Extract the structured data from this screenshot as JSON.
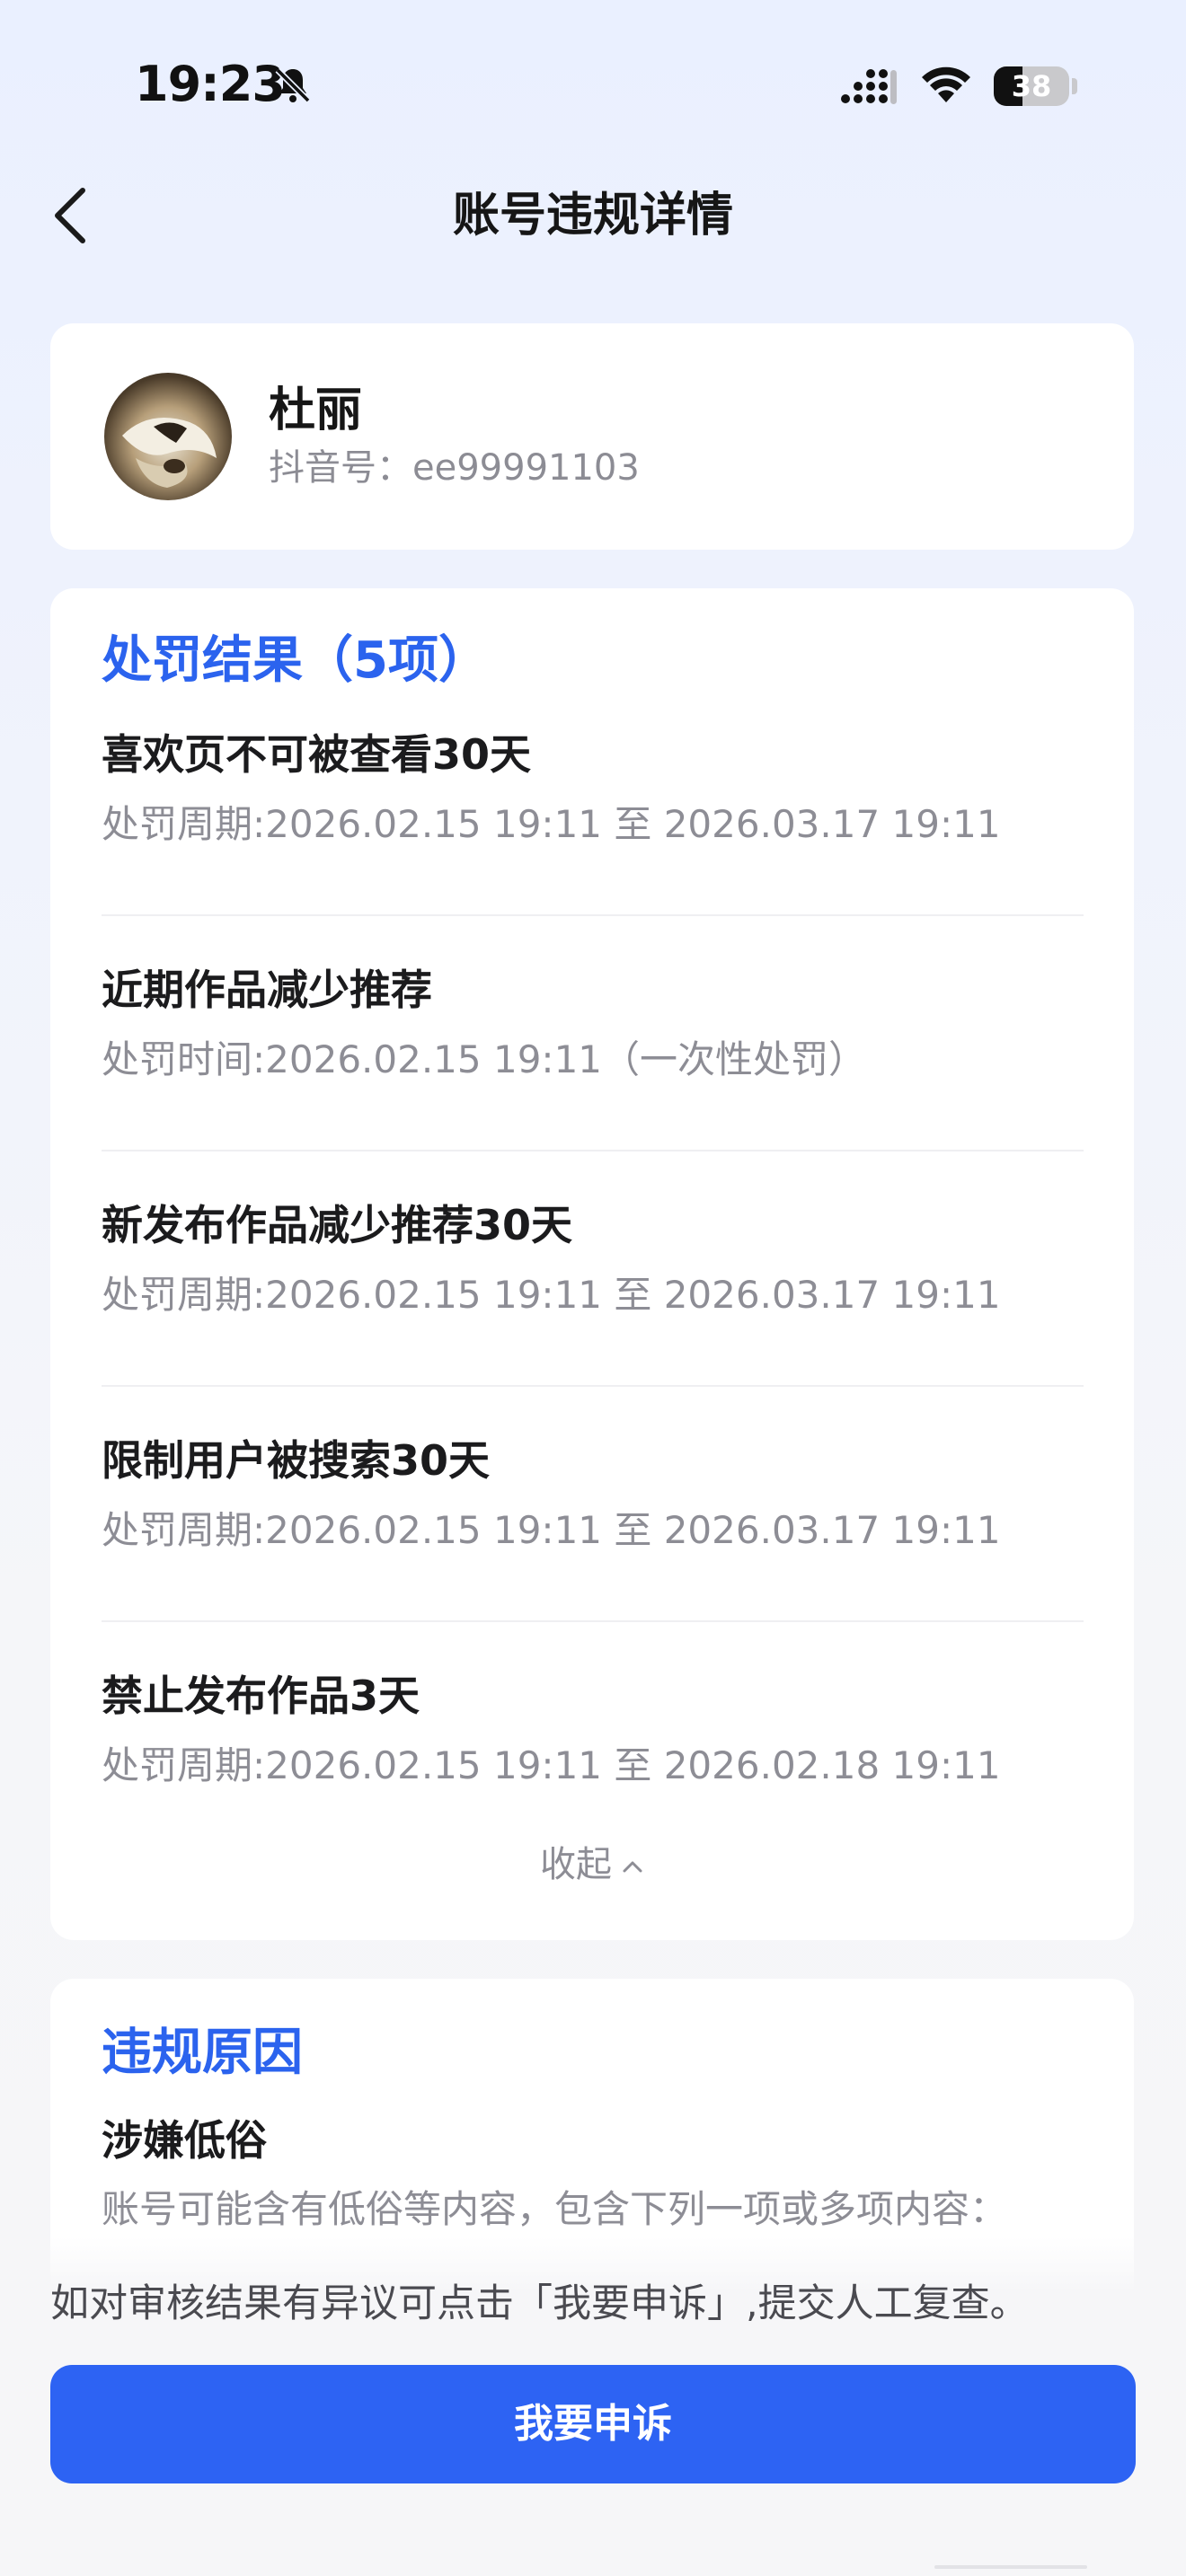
{
  "status_bar": {
    "time": "19:23",
    "battery_level": "38",
    "battery_fraction": 0.38,
    "icons": [
      "bell-muted-icon",
      "signal-icon",
      "wifi-icon",
      "battery-icon"
    ]
  },
  "nav": {
    "back_icon": "chevron-left-icon",
    "title": "账号违规详情"
  },
  "user": {
    "name": "杜丽",
    "id_label": "抖音号：ee99991103"
  },
  "penalties": {
    "heading": "处罚结果（5项）",
    "items": [
      {
        "title": "喜欢页不可被查看30天",
        "period": "处罚周期:2026.02.15 19:11 至 2026.03.17 19:11"
      },
      {
        "title": "近期作品减少推荐",
        "period": "处罚时间:2026.02.15 19:11（一次性处罚）"
      },
      {
        "title": "新发布作品减少推荐30天",
        "period": "处罚周期:2026.02.15 19:11 至 2026.03.17 19:11"
      },
      {
        "title": "限制用户被搜索30天",
        "period": "处罚周期:2026.02.15 19:11 至 2026.03.17 19:11"
      },
      {
        "title": "禁止发布作品3天",
        "period": "处罚周期:2026.02.15 19:11 至 2026.02.18 19:11"
      }
    ],
    "collapse_label": "收起"
  },
  "violation": {
    "heading": "违规原因",
    "title": "涉嫌低俗",
    "description": "账号可能含有低俗等内容，包含下列一项或多项内容："
  },
  "footer": {
    "hint": "如对审核结果有异议可点击「我要申诉」,提交人工复查。",
    "appeal_button": "我要申诉"
  },
  "colors": {
    "accent": "#2d63f3",
    "heading_blue": "#2b63ee",
    "background": "#eaf0ff"
  }
}
